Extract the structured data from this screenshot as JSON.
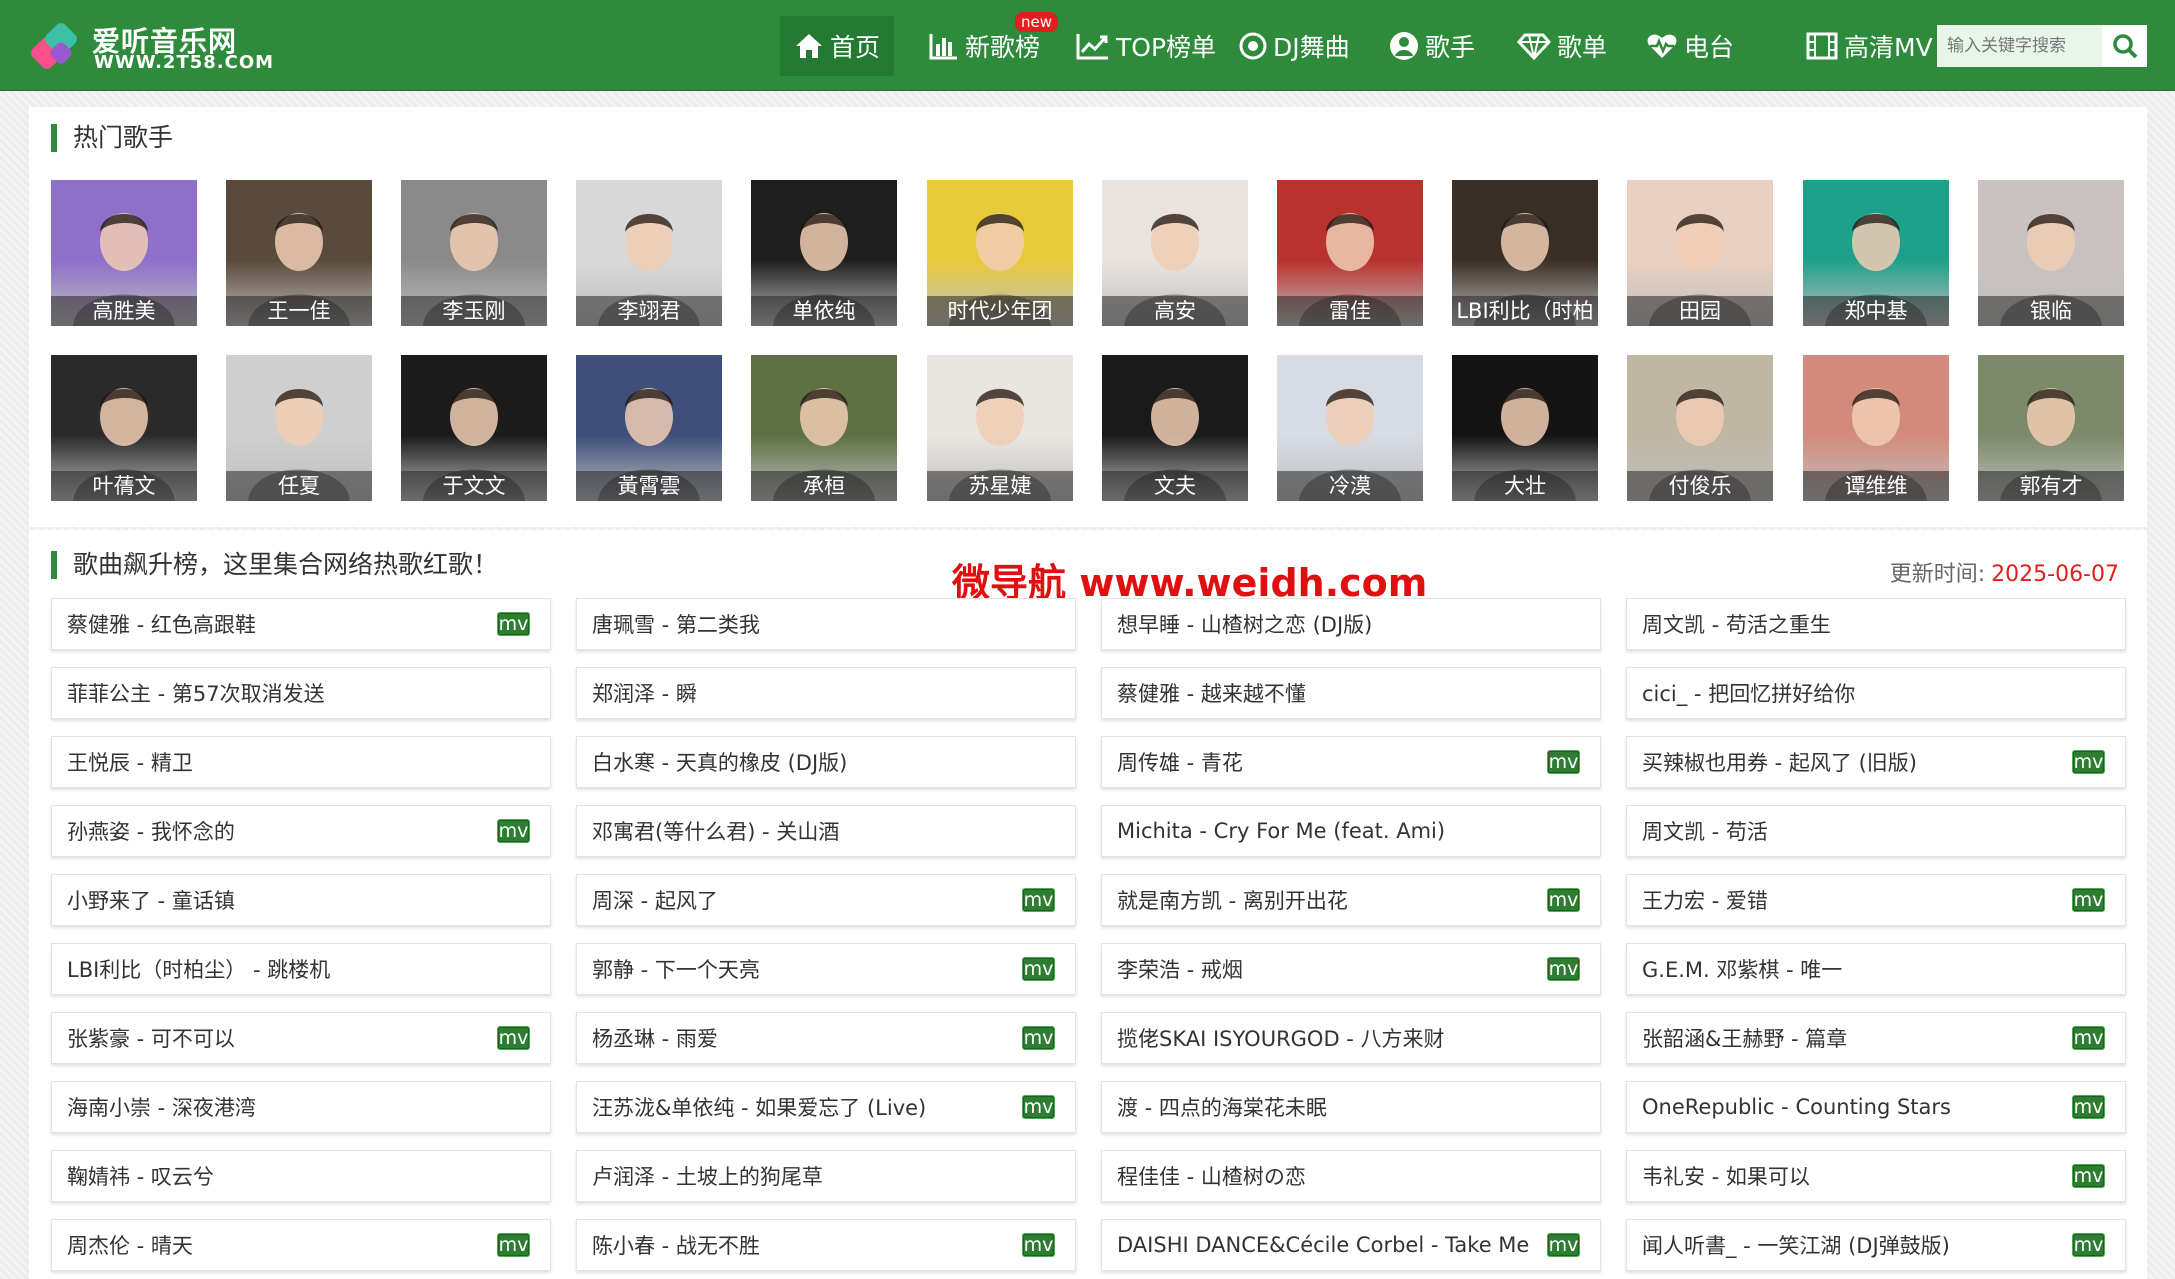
{
  "header": {
    "logo_cn": "爱听音乐网",
    "logo_url": "WWW.2T58.COM",
    "nav": [
      {
        "label": "首页",
        "icon": "home-icon",
        "active": true
      },
      {
        "label": "新歌榜",
        "icon": "bar-chart-icon",
        "badge": "new"
      },
      {
        "label": "TOP榜单",
        "icon": "trend-icon"
      },
      {
        "label": "DJ舞曲",
        "icon": "disc-icon"
      },
      {
        "label": "歌手",
        "icon": "user-icon"
      },
      {
        "label": "歌单",
        "icon": "diamond-icon"
      },
      {
        "label": "电台",
        "icon": "heartbeat-icon"
      },
      {
        "label": "高清MV",
        "icon": "film-icon"
      }
    ],
    "search_placeholder": "输入关键字搜索"
  },
  "artists_section": {
    "title": "热门歌手",
    "artists": [
      {
        "name": "高胜美",
        "color": "#8e6fc9"
      },
      {
        "name": "王一佳",
        "color": "#5a4a3c"
      },
      {
        "name": "李玉刚",
        "color": "#8a8a8a"
      },
      {
        "name": "李翊君",
        "color": "#d8d8d8"
      },
      {
        "name": "单依纯",
        "color": "#1e1e1e"
      },
      {
        "name": "时代少年团",
        "color": "#e8c93a"
      },
      {
        "name": "高安",
        "color": "#e9e4e0"
      },
      {
        "name": "雷佳",
        "color": "#b8322e"
      },
      {
        "name": "LBI利比（时柏",
        "color": "#3a2f26"
      },
      {
        "name": "田园",
        "color": "#ead0c0"
      },
      {
        "name": "郑中基",
        "color": "#1fa08a"
      },
      {
        "name": "银临",
        "color": "#c9c2c0"
      },
      {
        "name": "叶蒨文",
        "color": "#2a2a2a"
      },
      {
        "name": "任夏",
        "color": "#cfcfcf"
      },
      {
        "name": "于文文",
        "color": "#1b1b1b"
      },
      {
        "name": "黃霄雲",
        "color": "#3d4f7a"
      },
      {
        "name": "承桓",
        "color": "#5f7044"
      },
      {
        "name": "苏星婕",
        "color": "#e9e6e2"
      },
      {
        "name": "文夫",
        "color": "#1a1a1a"
      },
      {
        "name": "冷漠",
        "color": "#d7dbe3"
      },
      {
        "name": "大壮",
        "color": "#141414"
      },
      {
        "name": "付俊乐",
        "color": "#bfb6a4"
      },
      {
        "name": "谭维维",
        "color": "#d38a7c"
      },
      {
        "name": "郭有才",
        "color": "#7c8a6a"
      }
    ]
  },
  "songs_section": {
    "title": "歌曲飙升榜，这里集合网络热歌红歌！",
    "watermark": "微导航 www.weidh.com",
    "update_label": "更新时间:",
    "update_date": "2025-06-07",
    "mv_label": "mv",
    "rows": [
      [
        {
          "t": "蔡健雅 - 红色高跟鞋",
          "mv": true
        },
        {
          "t": "唐珮雪 - 第二类我",
          "mv": false
        },
        {
          "t": "想早睡 - 山楂树之恋 (DJ版)",
          "mv": false
        },
        {
          "t": "周文凯 - 苟活之重生",
          "mv": false
        }
      ],
      [
        {
          "t": "菲菲公主 - 第57次取消发送",
          "mv": false
        },
        {
          "t": "郑润泽 - 瞬",
          "mv": false
        },
        {
          "t": "蔡健雅 - 越来越不懂",
          "mv": false
        },
        {
          "t": "cici_ - 把回忆拼好给你",
          "mv": false
        }
      ],
      [
        {
          "t": "王悦辰 - 精卫",
          "mv": false
        },
        {
          "t": "白水寒 - 天真的橡皮 (DJ版)",
          "mv": false
        },
        {
          "t": "周传雄 - 青花",
          "mv": true
        },
        {
          "t": "买辣椒也用券 - 起风了 (旧版)",
          "mv": true
        }
      ],
      [
        {
          "t": "孙燕姿 - 我怀念的",
          "mv": true
        },
        {
          "t": "邓寓君(等什么君) - 关山酒",
          "mv": false
        },
        {
          "t": "Michita - Cry For Me (feat. Ami)",
          "mv": false
        },
        {
          "t": "周文凯 - 苟活",
          "mv": false
        }
      ],
      [
        {
          "t": "小野来了 - 童话镇",
          "mv": false
        },
        {
          "t": "周深 - 起风了",
          "mv": true
        },
        {
          "t": "就是南方凯 - 离别开出花",
          "mv": true
        },
        {
          "t": "王力宏 - 爱错",
          "mv": true
        }
      ],
      [
        {
          "t": "LBI利比（时柏尘） - 跳楼机",
          "mv": false
        },
        {
          "t": "郭静 - 下一个天亮",
          "mv": true
        },
        {
          "t": "李荣浩 - 戒烟",
          "mv": true
        },
        {
          "t": "G.E.M. 邓紫棋 - 唯一",
          "mv": false
        }
      ],
      [
        {
          "t": "张紫豪 - 可不可以",
          "mv": true
        },
        {
          "t": "杨丞琳 - 雨爱",
          "mv": true
        },
        {
          "t": "揽佬SKAI ISYOURGOD - 八方来财",
          "mv": false
        },
        {
          "t": "张韶涵&王赫野 - 篇章",
          "mv": true
        }
      ],
      [
        {
          "t": "海南小崇 - 深夜港湾",
          "mv": false
        },
        {
          "t": "汪苏泷&单依纯 - 如果爱忘了 (Live)",
          "mv": true
        },
        {
          "t": "渡 - 四点的海棠花未眠",
          "mv": false
        },
        {
          "t": "OneRepublic - Counting Stars",
          "mv": true
        }
      ],
      [
        {
          "t": "鞠婧祎 - 叹云兮",
          "mv": false
        },
        {
          "t": "卢润泽 - 土坡上的狗尾草",
          "mv": false
        },
        {
          "t": "程佳佳 - 山楂树の恋",
          "mv": false
        },
        {
          "t": "韦礼安 - 如果可以",
          "mv": true
        }
      ],
      [
        {
          "t": "周杰伦 - 晴天",
          "mv": true
        },
        {
          "t": "陈小春 - 战无不胜",
          "mv": true
        },
        {
          "t": "DAISHI DANCE&Cécile Corbel - Take Me",
          "mv": true
        },
        {
          "t": "闻人听書_ - 一笑江湖 (DJ弹鼓版)",
          "mv": true
        }
      ]
    ]
  }
}
